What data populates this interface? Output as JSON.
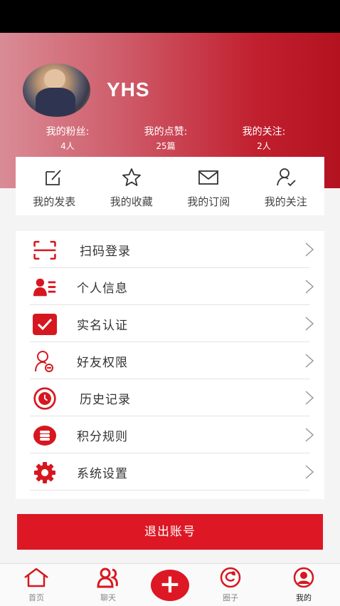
{
  "profile": {
    "username": "YHS"
  },
  "stats": [
    {
      "label": "我的粉丝:",
      "value": "4人"
    },
    {
      "label": "我的点赞:",
      "value": "25篇"
    },
    {
      "label": "我的关注:",
      "value": "2人"
    }
  ],
  "quick_actions": [
    {
      "label": "我的发表",
      "icon": "edit-icon"
    },
    {
      "label": "我的收藏",
      "icon": "star-icon"
    },
    {
      "label": "我的订阅",
      "icon": "mail-icon"
    },
    {
      "label": "我的关注",
      "icon": "user-check-icon"
    }
  ],
  "menu": [
    {
      "label": "扫码登录",
      "icon": "scan-icon"
    },
    {
      "label": "个人信息",
      "icon": "profile-card-icon"
    },
    {
      "label": "实名认证",
      "icon": "checkbox-icon"
    },
    {
      "label": "好友权限",
      "icon": "user-permission-icon"
    },
    {
      "label": "历史记录",
      "icon": "clock-icon"
    },
    {
      "label": "积分规则",
      "icon": "coins-icon"
    },
    {
      "label": "系统设置",
      "icon": "gear-icon"
    }
  ],
  "logout_label": "退出账号",
  "tabbar": {
    "home": "首页",
    "chat": "聊天",
    "create": "+",
    "circle": "圈子",
    "mine": "我的"
  },
  "colors": {
    "accent": "#dd1724",
    "icon_red": "#d7171f"
  }
}
